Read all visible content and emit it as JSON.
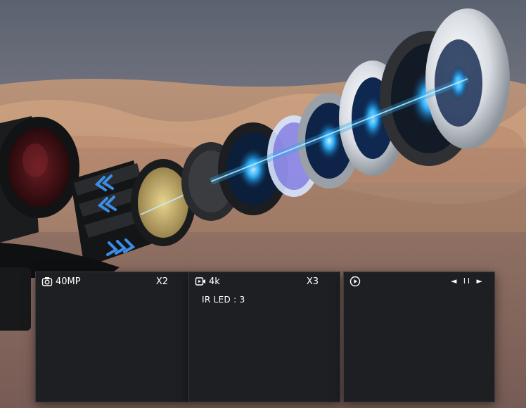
{
  "panels": [
    {
      "icon": "camera-icon",
      "label": "40MP",
      "zoom": "X2"
    },
    {
      "icon": "video-icon",
      "label": "4k",
      "zoom": "X3",
      "overlay": "IR LED : 3"
    },
    {
      "icon": "play-icon",
      "controls": "◄ ll ►"
    }
  ],
  "colors": {
    "panel": "#1d1f22",
    "lens_blue": "#2aa7f0",
    "arrow": "#3b8ee8"
  }
}
